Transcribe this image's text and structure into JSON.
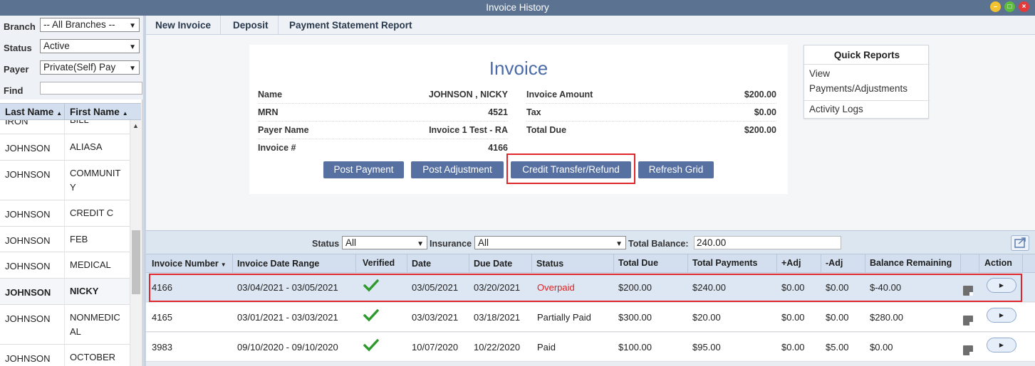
{
  "window": {
    "title": "Invoice History"
  },
  "filters": {
    "branch": {
      "label": "Branch",
      "value": "-- All Branches --"
    },
    "status": {
      "label": "Status",
      "value": "Active"
    },
    "payer": {
      "label": "Payer",
      "value": "Private(Self) Pay"
    },
    "find": {
      "label": "Find",
      "value": ""
    }
  },
  "patient_list": {
    "headers": [
      "Last Name",
      "First Name"
    ],
    "rows": [
      {
        "last": "IRON",
        "first": "BILL"
      },
      {
        "last": "JOHNSON",
        "first": "ALIASA"
      },
      {
        "last": "JOHNSON",
        "first": "COMMUNIT Y"
      },
      {
        "last": "JOHNSON",
        "first": "CREDIT C"
      },
      {
        "last": "JOHNSON",
        "first": "FEB"
      },
      {
        "last": "JOHNSON",
        "first": "MEDICAL"
      },
      {
        "last": "JOHNSON",
        "first": "NICKY"
      },
      {
        "last": "JOHNSON",
        "first": "NONMEDIC AL"
      },
      {
        "last": "JOHNSON",
        "first": "OCTOBER"
      }
    ]
  },
  "toolbar": {
    "new_invoice": "New Invoice",
    "deposit": "Deposit",
    "payment_statement": "Payment Statement Report"
  },
  "invoice": {
    "title": "Invoice",
    "name_label": "Name",
    "name": "JOHNSON , NICKY",
    "mrn_label": "MRN",
    "mrn": "4521",
    "payer_label": "Payer Name",
    "payer": "Invoice 1 Test - RA",
    "invno_label": "Invoice #",
    "invno": "4166",
    "amount_label": "Invoice Amount",
    "amount": "$200.00",
    "tax_label": "Tax",
    "tax": "$0.00",
    "total_label": "Total Due",
    "total": "$200.00",
    "buttons": {
      "post_payment": "Post Payment",
      "post_adjustment": "Post Adjustment",
      "credit_transfer": "Credit Transfer/Refund",
      "refresh": "Refresh Grid"
    }
  },
  "quick_reports": {
    "title": "Quick Reports",
    "item1_line1": "View",
    "item1_line2": "Payments/Adjustments",
    "item2": "Activity Logs"
  },
  "grid_filter": {
    "status_label": "Status",
    "status_value": "All",
    "insurance_label": "Insurance",
    "insurance_value": "All",
    "balance_label": "Total Balance:",
    "balance_value": "240.00"
  },
  "grid": {
    "headers": {
      "invoice_number": "Invoice Number",
      "date_range": "Invoice Date Range",
      "verified": "Verified",
      "date": "Date",
      "due_date": "Due Date",
      "status": "Status",
      "total_due": "Total Due",
      "total_payments": "Total Payments",
      "plus_adj": "+Adj",
      "minus_adj": "-Adj",
      "balance": "Balance Remaining",
      "action": "Action"
    },
    "rows": [
      {
        "number": "4166",
        "range": "03/04/2021 - 03/05/2021",
        "date": "03/05/2021",
        "due": "03/20/2021",
        "status": "Overpaid",
        "total": "$200.00",
        "payments": "$240.00",
        "plus": "$0.00",
        "minus": "$0.00",
        "balance": "$-40.00"
      },
      {
        "number": "4165",
        "range": "03/01/2021 - 03/03/2021",
        "date": "03/03/2021",
        "due": "03/18/2021",
        "status": "Partially Paid",
        "total": "$300.00",
        "payments": "$20.00",
        "plus": "$0.00",
        "minus": "$0.00",
        "balance": "$280.00"
      },
      {
        "number": "3983",
        "range": "09/10/2020 - 09/10/2020",
        "date": "10/07/2020",
        "due": "10/22/2020",
        "status": "Paid",
        "total": "$100.00",
        "payments": "$95.00",
        "plus": "$0.00",
        "minus": "$5.00",
        "balance": "$0.00"
      }
    ]
  }
}
